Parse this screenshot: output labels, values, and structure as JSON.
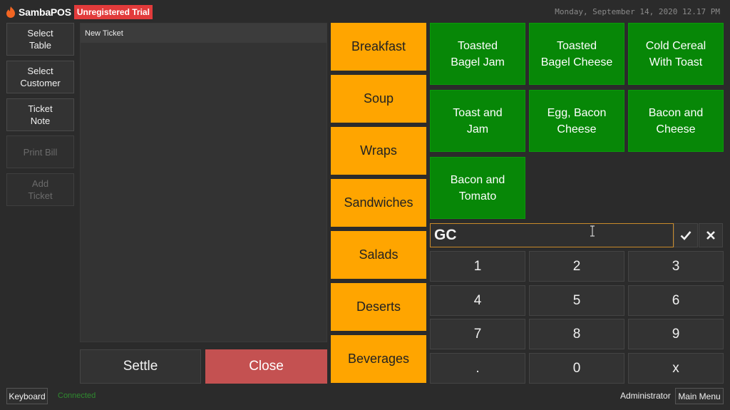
{
  "header": {
    "logo_text": "SambaPOS",
    "trial_badge": "Unregistered Trial",
    "datetime": "Monday, September 14, 2020 12.17 PM"
  },
  "side_buttons": [
    {
      "label": "Select\nTable"
    },
    {
      "label": "Select\nCustomer"
    },
    {
      "label": "Ticket\nNote"
    },
    {
      "label": "Print Bill"
    },
    {
      "label": "Add\nTicket"
    }
  ],
  "ticket": {
    "title": "New Ticket",
    "settle_label": "Settle",
    "close_label": "Close"
  },
  "categories": [
    {
      "label": "Breakfast"
    },
    {
      "label": "Soup"
    },
    {
      "label": "Wraps"
    },
    {
      "label": "Sandwiches"
    },
    {
      "label": "Salads"
    },
    {
      "label": "Deserts"
    },
    {
      "label": "Beverages"
    }
  ],
  "menu_items": [
    {
      "label": "Toasted\nBagel Jam"
    },
    {
      "label": "Toasted\nBagel Cheese"
    },
    {
      "label": "Cold Cereal\nWith Toast"
    },
    {
      "label": "Toast and\nJam"
    },
    {
      "label": "Egg, Bacon\nCheese"
    },
    {
      "label": "Bacon and\nCheese"
    },
    {
      "label": "Bacon and\nTomato"
    }
  ],
  "numpad": {
    "input_value": "GC",
    "keys": [
      "1",
      "2",
      "3",
      "4",
      "5",
      "6",
      "7",
      "8",
      "9",
      ".",
      "0",
      "x"
    ]
  },
  "footer": {
    "keyboard_label": "Keyboard",
    "status": "Connected",
    "user": "Administrator",
    "main_menu_label": "Main Menu"
  },
  "colors": {
    "background": "#2b2b2b",
    "category": "#ffa500",
    "menu_item": "#078707",
    "close": "#c45151",
    "trial": "#e23b3b",
    "connected": "#2f8a2f"
  }
}
